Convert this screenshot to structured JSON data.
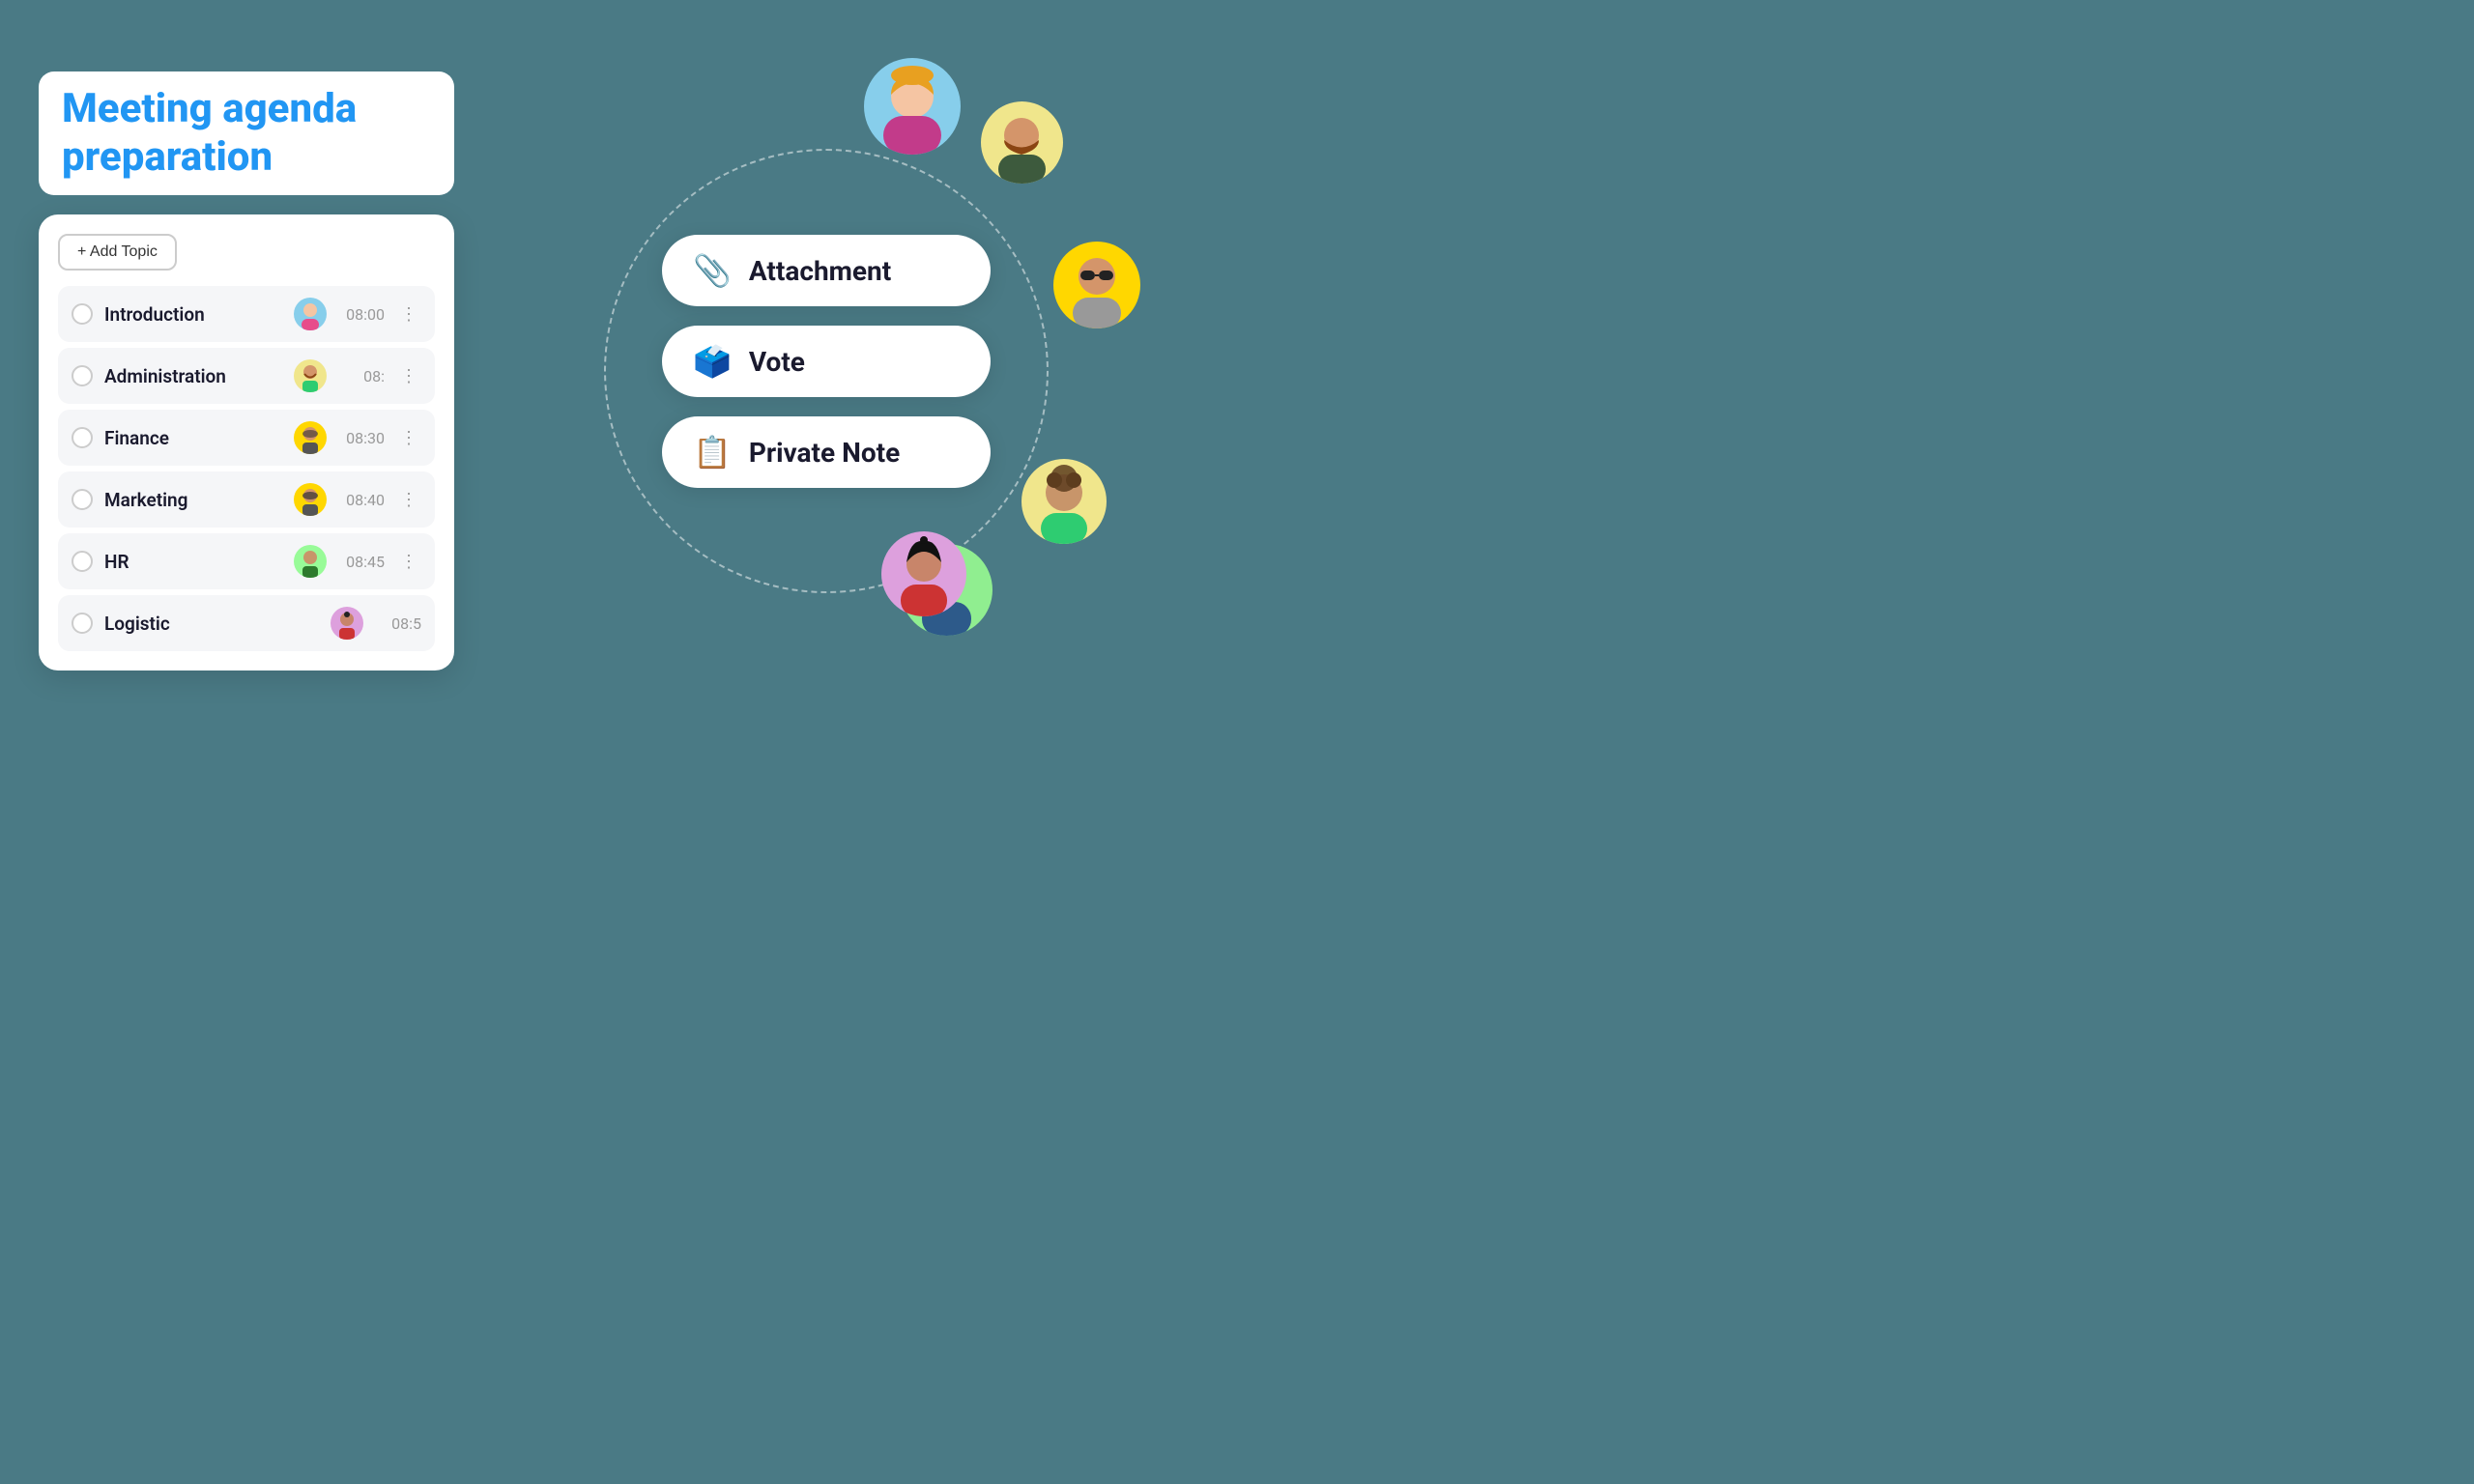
{
  "page": {
    "title": "Meeting agenda preparation",
    "background_color": "#4a7a85"
  },
  "add_topic_button": {
    "label": "+ Add Topic"
  },
  "agenda_items": [
    {
      "id": 1,
      "name": "Introduction",
      "time": "08:00",
      "avatar_color": "#87ceeb",
      "avatar_emoji": "👤"
    },
    {
      "id": 2,
      "name": "Administration",
      "time": "08:",
      "avatar_color": "#f0e68c",
      "avatar_emoji": "👤"
    },
    {
      "id": 3,
      "name": "Finance",
      "time": "08:30",
      "avatar_color": "#ffd700",
      "avatar_emoji": "👤"
    },
    {
      "id": 4,
      "name": "Marketing",
      "time": "08:40",
      "avatar_color": "#ffd700",
      "avatar_emoji": "👤"
    },
    {
      "id": 5,
      "name": "HR",
      "time": "08:45",
      "avatar_color": "#98fb98",
      "avatar_emoji": "👤"
    },
    {
      "id": 6,
      "name": "Logistic",
      "time": "08:5",
      "avatar_color": "#dda0dd",
      "avatar_emoji": "👤"
    }
  ],
  "action_items": [
    {
      "id": "attachment",
      "label": "Attachment",
      "icon": "📎",
      "color": "#e74c3c"
    },
    {
      "id": "vote",
      "label": "Vote",
      "icon": "✅",
      "color": "#666"
    },
    {
      "id": "private_note",
      "label": "Private Note",
      "icon": "📝",
      "color": "#f0c040"
    }
  ],
  "avatars": [
    {
      "id": "av1",
      "bg": "#87ceeb",
      "label": "blonde woman"
    },
    {
      "id": "av2",
      "bg": "#f0e68c",
      "label": "bearded man"
    },
    {
      "id": "av3",
      "bg": "#ffd700",
      "label": "sunglasses person"
    },
    {
      "id": "av4",
      "bg": "#f0e68c",
      "label": "curly hair person"
    },
    {
      "id": "av5",
      "bg": "#90ee90",
      "label": "woman green"
    },
    {
      "id": "av6",
      "bg": "#dda0dd",
      "label": "dark hair woman"
    }
  ]
}
